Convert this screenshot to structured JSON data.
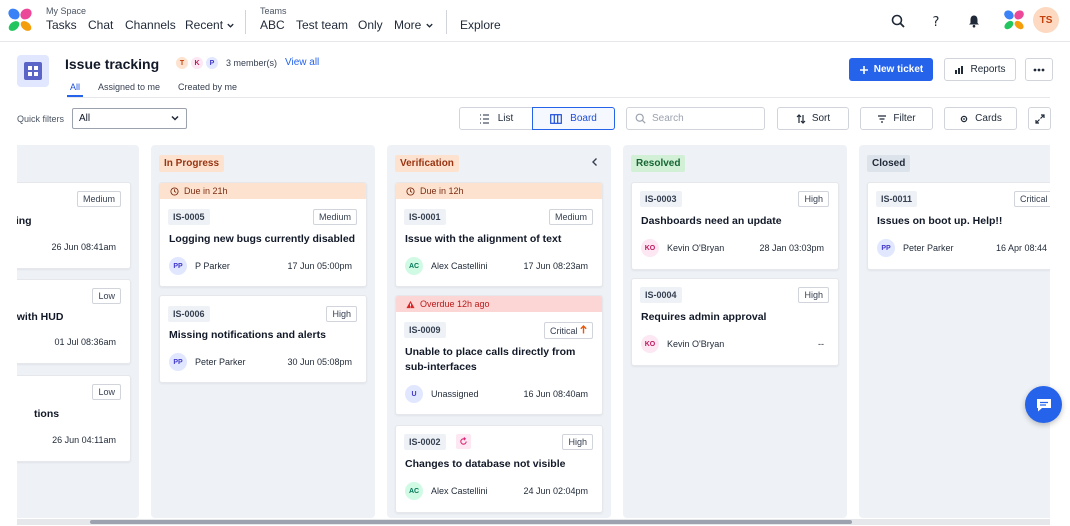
{
  "nav": {
    "my_space_label": "My Space",
    "teams_label": "Teams",
    "items": [
      "Tasks",
      "Chat",
      "Channels",
      "Recent",
      "ABC",
      "Test team",
      "Only",
      "More",
      "Explore"
    ],
    "avatar_initials": "TS"
  },
  "header": {
    "title": "Issue tracking",
    "member_initials": [
      "T",
      "K",
      "P"
    ],
    "members_text": "3 member(s)",
    "view_all": "View all",
    "tabs": [
      "All",
      "Assigned to me",
      "Created by me"
    ],
    "new_ticket": "New ticket",
    "reports": "Reports"
  },
  "toolbar": {
    "quick_filters_label": "Quick filters",
    "quick_filter_value": "All",
    "list_label": "List",
    "board_label": "Board",
    "search_placeholder": "Search",
    "sort_label": "Sort",
    "filter_label": "Filter",
    "cards_label": "Cards"
  },
  "columns": [
    {
      "name": "",
      "cards": [
        {
          "priority": "Medium",
          "title": "king",
          "date": "26 Jun 08:41am"
        },
        {
          "priority": "Low",
          "title": "ng with HUD",
          "date": "01 Jul 08:36am"
        },
        {
          "priority": "Low",
          "title": "tions",
          "date": "26 Jun 04:11am"
        }
      ]
    },
    {
      "name": "In Progress",
      "cards": [
        {
          "banner": "Due in 21h",
          "id": "IS-0005",
          "priority": "Medium",
          "title": "Logging new bugs currently disabled",
          "assignee_initials": "PP",
          "assignee": "P Parker",
          "date": "17 Jun 05:00pm"
        },
        {
          "id": "IS-0006",
          "priority": "High",
          "title": "Missing notifications and alerts",
          "assignee_initials": "PP",
          "assignee": "Peter Parker",
          "date": "30 Jun 05:08pm"
        }
      ]
    },
    {
      "name": "Verification",
      "cards": [
        {
          "banner": "Due in 12h",
          "id": "IS-0001",
          "priority": "Medium",
          "title": "Issue with the alignment of text",
          "assignee_initials": "AC",
          "assignee": "Alex Castellini",
          "date": "17 Jun 08:23am"
        },
        {
          "banner": "Overdue 12h ago",
          "id": "IS-0009",
          "priority": "Critical",
          "title": "Unable to place calls directly from sub-interfaces",
          "assignee_initials": "U",
          "assignee": "Unassigned",
          "date": "16 Jun 08:40am"
        },
        {
          "id": "IS-0002",
          "priority": "High",
          "title": "Changes to database not visible",
          "assignee_initials": "AC",
          "assignee": "Alex Castellini",
          "date": "24 Jun 02:04pm"
        }
      ]
    },
    {
      "name": "Resolved",
      "cards": [
        {
          "id": "IS-0003",
          "priority": "High",
          "title": "Dashboards need an update",
          "assignee_initials": "KO",
          "assignee": "Kevin O'Bryan",
          "date": "28 Jan 03:03pm"
        },
        {
          "id": "IS-0004",
          "priority": "High",
          "title": "Requires admin approval",
          "assignee_initials": "KO",
          "assignee": "Kevin O'Bryan",
          "date": "--"
        }
      ]
    },
    {
      "name": "Closed",
      "cards": [
        {
          "id": "IS-0011",
          "priority": "Critical",
          "title": "Issues on boot up. Help!!",
          "assignee_initials": "PP",
          "assignee": "Peter Parker",
          "date": "16 Apr 08:44"
        }
      ]
    }
  ],
  "colors": {
    "accent": "#2563eb",
    "in_progress_bg": "#fde3cf",
    "verification_bg": "#fde3cf",
    "resolved_bg": "#d1f0d6",
    "closed_bg": "#dde3ea",
    "due_banner": "#fde3cf",
    "overdue_banner": "#fcd5d5"
  }
}
